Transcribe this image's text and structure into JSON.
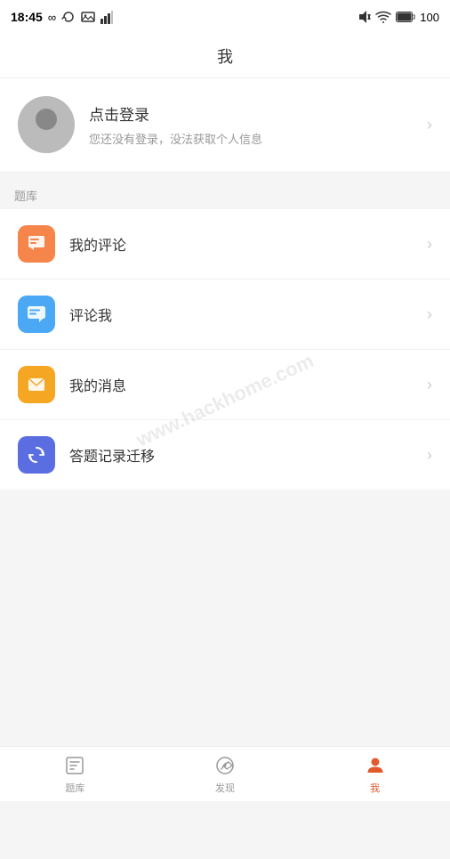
{
  "statusBar": {
    "time": "18:45",
    "battery": "100"
  },
  "header": {
    "title": "我"
  },
  "profile": {
    "loginText": "点击登录",
    "hintText": "您还没有登录，没法获取个人信息",
    "chevron": "›"
  },
  "sectionLabel": "题库",
  "menuItems": [
    {
      "id": "my-comments",
      "label": "我的评论",
      "iconColor": "icon-orange",
      "iconType": "comment"
    },
    {
      "id": "comment-me",
      "label": "评论我",
      "iconColor": "icon-blue",
      "iconType": "chat"
    },
    {
      "id": "my-messages",
      "label": "我的消息",
      "iconColor": "icon-gold",
      "iconType": "message"
    },
    {
      "id": "migration",
      "label": "答题记录迁移",
      "iconColor": "icon-purple",
      "iconType": "transfer"
    }
  ],
  "tabBar": {
    "items": [
      {
        "id": "tiku",
        "label": "题库",
        "active": false
      },
      {
        "id": "discover",
        "label": "发现",
        "active": false
      },
      {
        "id": "me",
        "label": "我",
        "active": true
      }
    ]
  }
}
